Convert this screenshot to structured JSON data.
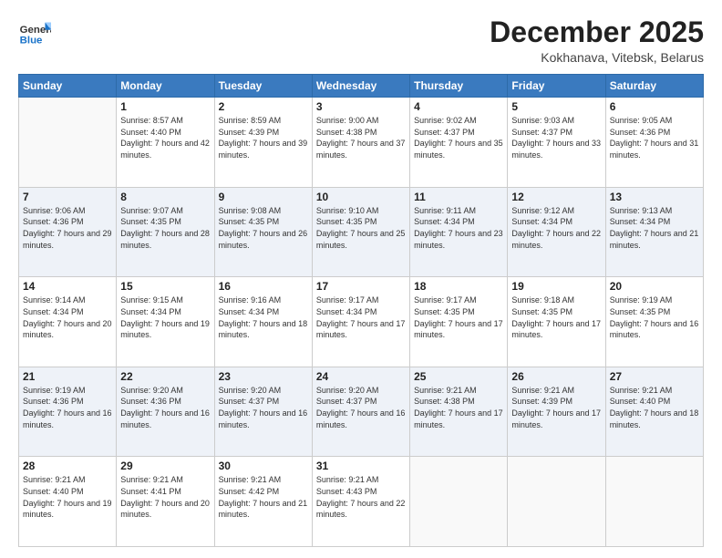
{
  "header": {
    "logo_general": "General",
    "logo_blue": "Blue",
    "month_title": "December 2025",
    "location": "Kokhanava, Vitebsk, Belarus"
  },
  "weekdays": [
    "Sunday",
    "Monday",
    "Tuesday",
    "Wednesday",
    "Thursday",
    "Friday",
    "Saturday"
  ],
  "weeks": [
    [
      {
        "day": "",
        "sunrise": "",
        "sunset": "",
        "daylight": ""
      },
      {
        "day": "1",
        "sunrise": "Sunrise: 8:57 AM",
        "sunset": "Sunset: 4:40 PM",
        "daylight": "Daylight: 7 hours and 42 minutes."
      },
      {
        "day": "2",
        "sunrise": "Sunrise: 8:59 AM",
        "sunset": "Sunset: 4:39 PM",
        "daylight": "Daylight: 7 hours and 39 minutes."
      },
      {
        "day": "3",
        "sunrise": "Sunrise: 9:00 AM",
        "sunset": "Sunset: 4:38 PM",
        "daylight": "Daylight: 7 hours and 37 minutes."
      },
      {
        "day": "4",
        "sunrise": "Sunrise: 9:02 AM",
        "sunset": "Sunset: 4:37 PM",
        "daylight": "Daylight: 7 hours and 35 minutes."
      },
      {
        "day": "5",
        "sunrise": "Sunrise: 9:03 AM",
        "sunset": "Sunset: 4:37 PM",
        "daylight": "Daylight: 7 hours and 33 minutes."
      },
      {
        "day": "6",
        "sunrise": "Sunrise: 9:05 AM",
        "sunset": "Sunset: 4:36 PM",
        "daylight": "Daylight: 7 hours and 31 minutes."
      }
    ],
    [
      {
        "day": "7",
        "sunrise": "Sunrise: 9:06 AM",
        "sunset": "Sunset: 4:36 PM",
        "daylight": "Daylight: 7 hours and 29 minutes."
      },
      {
        "day": "8",
        "sunrise": "Sunrise: 9:07 AM",
        "sunset": "Sunset: 4:35 PM",
        "daylight": "Daylight: 7 hours and 28 minutes."
      },
      {
        "day": "9",
        "sunrise": "Sunrise: 9:08 AM",
        "sunset": "Sunset: 4:35 PM",
        "daylight": "Daylight: 7 hours and 26 minutes."
      },
      {
        "day": "10",
        "sunrise": "Sunrise: 9:10 AM",
        "sunset": "Sunset: 4:35 PM",
        "daylight": "Daylight: 7 hours and 25 minutes."
      },
      {
        "day": "11",
        "sunrise": "Sunrise: 9:11 AM",
        "sunset": "Sunset: 4:34 PM",
        "daylight": "Daylight: 7 hours and 23 minutes."
      },
      {
        "day": "12",
        "sunrise": "Sunrise: 9:12 AM",
        "sunset": "Sunset: 4:34 PM",
        "daylight": "Daylight: 7 hours and 22 minutes."
      },
      {
        "day": "13",
        "sunrise": "Sunrise: 9:13 AM",
        "sunset": "Sunset: 4:34 PM",
        "daylight": "Daylight: 7 hours and 21 minutes."
      }
    ],
    [
      {
        "day": "14",
        "sunrise": "Sunrise: 9:14 AM",
        "sunset": "Sunset: 4:34 PM",
        "daylight": "Daylight: 7 hours and 20 minutes."
      },
      {
        "day": "15",
        "sunrise": "Sunrise: 9:15 AM",
        "sunset": "Sunset: 4:34 PM",
        "daylight": "Daylight: 7 hours and 19 minutes."
      },
      {
        "day": "16",
        "sunrise": "Sunrise: 9:16 AM",
        "sunset": "Sunset: 4:34 PM",
        "daylight": "Daylight: 7 hours and 18 minutes."
      },
      {
        "day": "17",
        "sunrise": "Sunrise: 9:17 AM",
        "sunset": "Sunset: 4:34 PM",
        "daylight": "Daylight: 7 hours and 17 minutes."
      },
      {
        "day": "18",
        "sunrise": "Sunrise: 9:17 AM",
        "sunset": "Sunset: 4:35 PM",
        "daylight": "Daylight: 7 hours and 17 minutes."
      },
      {
        "day": "19",
        "sunrise": "Sunrise: 9:18 AM",
        "sunset": "Sunset: 4:35 PM",
        "daylight": "Daylight: 7 hours and 17 minutes."
      },
      {
        "day": "20",
        "sunrise": "Sunrise: 9:19 AM",
        "sunset": "Sunset: 4:35 PM",
        "daylight": "Daylight: 7 hours and 16 minutes."
      }
    ],
    [
      {
        "day": "21",
        "sunrise": "Sunrise: 9:19 AM",
        "sunset": "Sunset: 4:36 PM",
        "daylight": "Daylight: 7 hours and 16 minutes."
      },
      {
        "day": "22",
        "sunrise": "Sunrise: 9:20 AM",
        "sunset": "Sunset: 4:36 PM",
        "daylight": "Daylight: 7 hours and 16 minutes."
      },
      {
        "day": "23",
        "sunrise": "Sunrise: 9:20 AM",
        "sunset": "Sunset: 4:37 PM",
        "daylight": "Daylight: 7 hours and 16 minutes."
      },
      {
        "day": "24",
        "sunrise": "Sunrise: 9:20 AM",
        "sunset": "Sunset: 4:37 PM",
        "daylight": "Daylight: 7 hours and 16 minutes."
      },
      {
        "day": "25",
        "sunrise": "Sunrise: 9:21 AM",
        "sunset": "Sunset: 4:38 PM",
        "daylight": "Daylight: 7 hours and 17 minutes."
      },
      {
        "day": "26",
        "sunrise": "Sunrise: 9:21 AM",
        "sunset": "Sunset: 4:39 PM",
        "daylight": "Daylight: 7 hours and 17 minutes."
      },
      {
        "day": "27",
        "sunrise": "Sunrise: 9:21 AM",
        "sunset": "Sunset: 4:40 PM",
        "daylight": "Daylight: 7 hours and 18 minutes."
      }
    ],
    [
      {
        "day": "28",
        "sunrise": "Sunrise: 9:21 AM",
        "sunset": "Sunset: 4:40 PM",
        "daylight": "Daylight: 7 hours and 19 minutes."
      },
      {
        "day": "29",
        "sunrise": "Sunrise: 9:21 AM",
        "sunset": "Sunset: 4:41 PM",
        "daylight": "Daylight: 7 hours and 20 minutes."
      },
      {
        "day": "30",
        "sunrise": "Sunrise: 9:21 AM",
        "sunset": "Sunset: 4:42 PM",
        "daylight": "Daylight: 7 hours and 21 minutes."
      },
      {
        "day": "31",
        "sunrise": "Sunrise: 9:21 AM",
        "sunset": "Sunset: 4:43 PM",
        "daylight": "Daylight: 7 hours and 22 minutes."
      },
      {
        "day": "",
        "sunrise": "",
        "sunset": "",
        "daylight": ""
      },
      {
        "day": "",
        "sunrise": "",
        "sunset": "",
        "daylight": ""
      },
      {
        "day": "",
        "sunrise": "",
        "sunset": "",
        "daylight": ""
      }
    ]
  ]
}
